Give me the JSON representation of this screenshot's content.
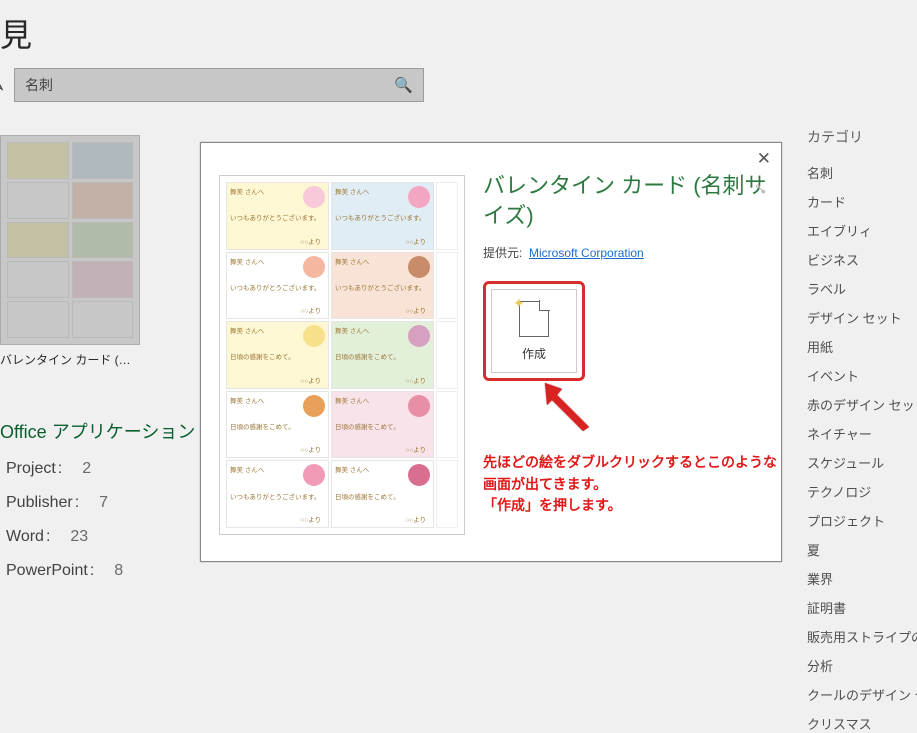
{
  "header": {
    "title": "見"
  },
  "search": {
    "left_label": "ム",
    "value": "名刺"
  },
  "thumb": {
    "caption": "バレンタイン カード (…"
  },
  "section": {
    "title": "Office アプリケーション"
  },
  "apps": [
    {
      "label": "Project",
      "count": "2"
    },
    {
      "label": "Publisher",
      "count": "7"
    },
    {
      "label": "Word",
      "count": "23"
    },
    {
      "label": "PowerPoint",
      "count": "8"
    }
  ],
  "categories": {
    "heading": "カテゴリ",
    "items": [
      "名刺",
      "カード",
      "エイブリィ",
      "ビジネス",
      "ラベル",
      "デザイン セット",
      "用紙",
      "イベント",
      "赤のデザイン セット",
      "ネイチャー",
      "スケジュール",
      "テクノロジ",
      "プロジェクト",
      "夏",
      "業界",
      "証明書",
      "販売用ストライプの",
      "分析",
      "クールのデザイン セ",
      "クリスマス"
    ]
  },
  "modal": {
    "title": "バレンタイン カード (名刺サイズ)",
    "provider_label": "提供元:",
    "provider_name": "Microsoft Corporation",
    "create_label": "作成",
    "callout": "先ほどの絵をダブルクリックするとこのような画面が出てきます。\n「作成」を押します。",
    "card": {
      "greet": "舞美 さんへ",
      "msg1": "いつもありがとうございます。",
      "msg2": "日頃の感謝をこめて。",
      "sig": "○○より"
    }
  }
}
